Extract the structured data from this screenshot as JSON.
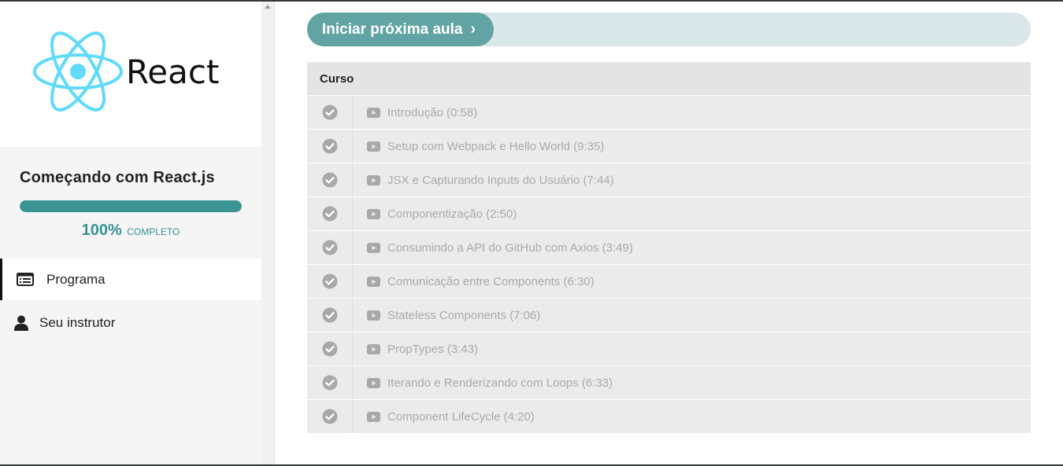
{
  "brand": {
    "logo_text": "React"
  },
  "course": {
    "title": "Começando com React.js",
    "progress_value": 100,
    "progress_percent": "100%",
    "progress_label": "COMPLETO"
  },
  "nav": {
    "items": [
      {
        "label": "Programa",
        "icon": "curriculum-list-icon",
        "active": true
      },
      {
        "label": "Seu instrutor",
        "icon": "user-icon",
        "active": false
      }
    ]
  },
  "next_lesson": {
    "label": "Iniciar próxima aula",
    "chevron": "›"
  },
  "curriculum": {
    "section_title": "Curso",
    "lessons": [
      {
        "title": "Introdução (0:58)",
        "completed": true
      },
      {
        "title": "Setup com Webpack e Hello World (9:35)",
        "completed": true
      },
      {
        "title": "JSX e Capturando Inputs do Usuário (7:44)",
        "completed": true
      },
      {
        "title": "Componentização (2:50)",
        "completed": true
      },
      {
        "title": "Consumindo a API do GitHub com Axios (3:49)",
        "completed": true
      },
      {
        "title": "Comunicação entre Components (6:30)",
        "completed": true
      },
      {
        "title": "Stateless Components (7:06)",
        "completed": true
      },
      {
        "title": "PropTypes (3:43)",
        "completed": true
      },
      {
        "title": "Iterando e Renderizando com Loops (6:33)",
        "completed": true
      },
      {
        "title": "Component LifeCycle (4:20)",
        "completed": true
      }
    ]
  },
  "colors": {
    "accent": "#3a9494",
    "button": "#62a3a4",
    "button_track": "#d9e7e8",
    "react_blue": "#61dafb"
  }
}
